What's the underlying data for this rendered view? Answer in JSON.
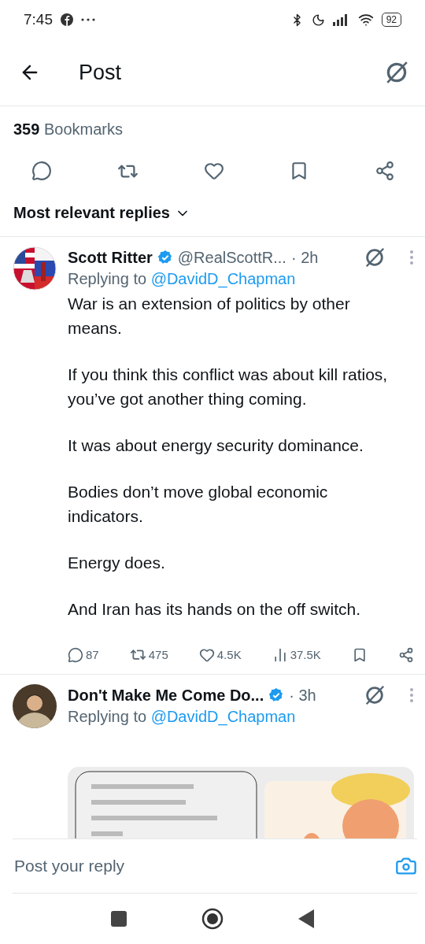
{
  "status_bar": {
    "time": "7:45",
    "battery": "92"
  },
  "header": {
    "title": "Post"
  },
  "stats": {
    "count": "359",
    "label": "Bookmarks"
  },
  "sort": {
    "label": "Most relevant replies"
  },
  "replies": [
    {
      "name": "Scott Ritter",
      "verified": true,
      "handle": "@RealScottR...",
      "time": "· 2h",
      "replying_prefix": "Replying to",
      "replying_to": "@DavidD_Chapman",
      "paragraphs": [
        "War is an extension of politics by other means.",
        "If you think this conflict was about kill ratios, you’ve got another thing coming.",
        "It was about energy security dominance.",
        "Bodies don’t move global economic indicators.",
        "Energy does.",
        "And Iran has its hands on the off switch."
      ],
      "counts": {
        "replies": "87",
        "reposts": "475",
        "likes": "4.5K",
        "views": "37.5K"
      }
    },
    {
      "name": "Don't Make Me Come Do...",
      "verified": true,
      "time": "· 3h",
      "replying_prefix": "Replying to",
      "replying_to": "@DavidD_Chapman"
    }
  ],
  "reply_bar": {
    "placeholder": "Post your reply"
  }
}
